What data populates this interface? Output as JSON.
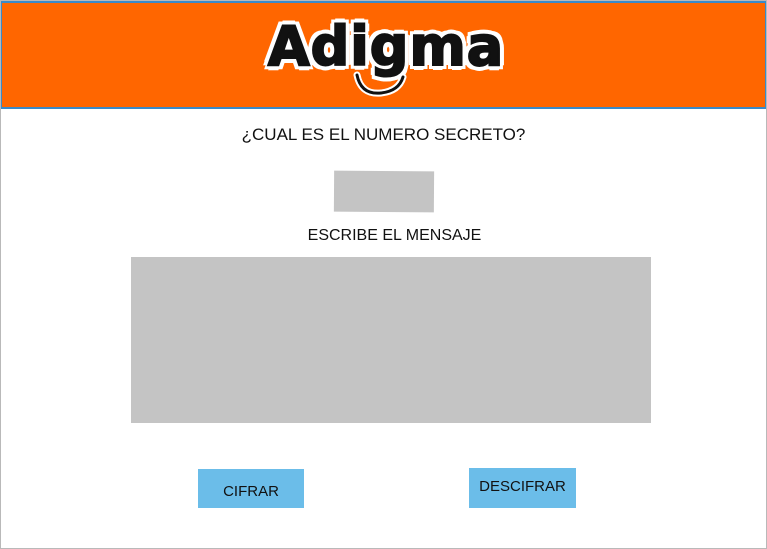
{
  "header": {
    "logo_text": "Adigma",
    "background_color": "#ff6600"
  },
  "form": {
    "question_label": "¿CUAL ES EL NUMERO SECRETO?",
    "secret_value": "",
    "message_label": "ESCRIBE EL MENSAJE",
    "message_value": ""
  },
  "actions": {
    "cifrar_label": "CIFRAR",
    "descifrar_label": "DESCIFRAR",
    "button_color": "#6bbde9"
  },
  "colors": {
    "input_fill": "#c4c4c4"
  }
}
